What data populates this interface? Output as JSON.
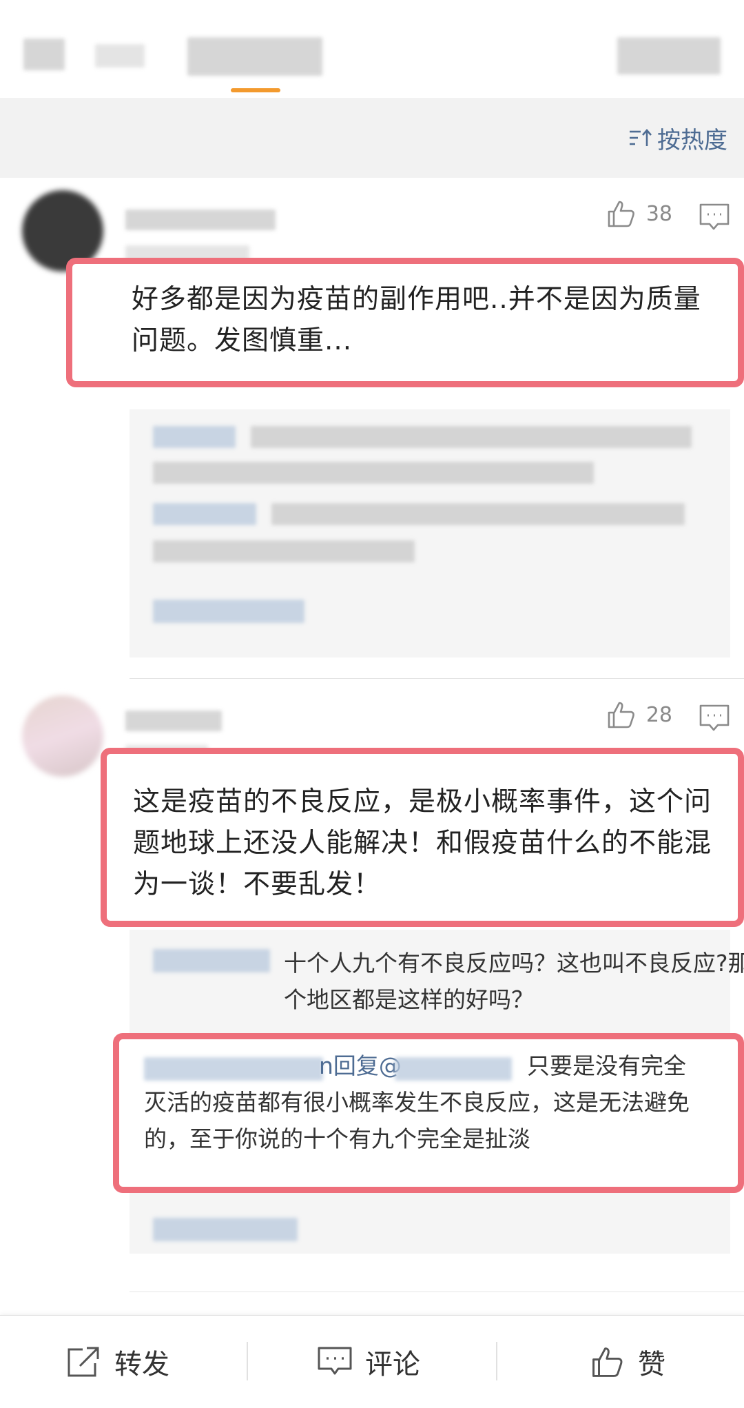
{
  "sort": {
    "label": "按热度"
  },
  "comments": [
    {
      "likes": "38",
      "text": "好多都是因为疫苗的副作用吧..并不是因为质量问题。发图慎重..."
    },
    {
      "likes": "28",
      "text": "这是疫苗的不良反应，是极小概率事件，这个问题地球上还没人能解决！和假疫苗什么的不能混为一谈！不要乱发！",
      "replies": [
        {
          "text": "十个人九个有不良反应吗？这也叫不良反应?那个地区都是这样的好吗？"
        },
        {
          "name_suffix": "n回复@",
          "text": "只要是没有完全灭活的疫苗都有很小概率发生不良反应，这是无法避免的，至于你说的十个有九个完全是扯淡"
        }
      ]
    }
  ],
  "bottom": {
    "forward": "转发",
    "comment": "评论",
    "like": "赞"
  },
  "colors": {
    "highlight": "#ee6f7b",
    "link": "#4e6c93",
    "tab_accent": "#f39a2e"
  }
}
